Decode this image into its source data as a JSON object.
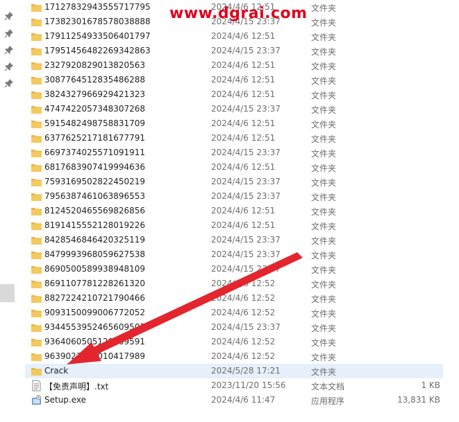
{
  "watermark": "www.dgrai.com",
  "accent_colors": {
    "folder": "#f4c95d",
    "selection": "#e5f0fb",
    "arrow": "#e3262e"
  },
  "nav_pane": {
    "pins": [
      "pin-icon",
      "pin-icon",
      "pin-icon",
      "pin-icon",
      "pin-icon"
    ]
  },
  "files": [
    {
      "name": "17127832943555717795",
      "date": "2024/4/6 12:51",
      "type": "文件夹",
      "size": "",
      "icon": "folder-icon"
    },
    {
      "name": "17382301678578038888",
      "date": "2024/4/15 23:37",
      "type": "文件夹",
      "size": "",
      "icon": "folder-icon"
    },
    {
      "name": "17911254933506401797",
      "date": "2024/4/6 12:51",
      "type": "文件夹",
      "size": "",
      "icon": "folder-icon"
    },
    {
      "name": "17951456482269342863",
      "date": "2024/4/15 23:37",
      "type": "文件夹",
      "size": "",
      "icon": "folder-icon"
    },
    {
      "name": "2327920829013820563",
      "date": "2024/4/6 12:51",
      "type": "文件夹",
      "size": "",
      "icon": "folder-icon"
    },
    {
      "name": "3087764512835486288",
      "date": "2024/4/6 12:51",
      "type": "文件夹",
      "size": "",
      "icon": "folder-icon"
    },
    {
      "name": "3824327966929421323",
      "date": "2024/4/6 12:51",
      "type": "文件夹",
      "size": "",
      "icon": "folder-icon"
    },
    {
      "name": "4747422057348307268",
      "date": "2024/4/15 23:37",
      "type": "文件夹",
      "size": "",
      "icon": "folder-icon"
    },
    {
      "name": "5915482498758831709",
      "date": "2024/4/6 12:51",
      "type": "文件夹",
      "size": "",
      "icon": "folder-icon"
    },
    {
      "name": "6377625217181677791",
      "date": "2024/4/6 12:51",
      "type": "文件夹",
      "size": "",
      "icon": "folder-icon"
    },
    {
      "name": "6697374025571091911",
      "date": "2024/4/15 23:37",
      "type": "文件夹",
      "size": "",
      "icon": "folder-icon"
    },
    {
      "name": "6817683907419994636",
      "date": "2024/4/6 12:51",
      "type": "文件夹",
      "size": "",
      "icon": "folder-icon"
    },
    {
      "name": "7593169502822450219",
      "date": "2024/4/15 23:37",
      "type": "文件夹",
      "size": "",
      "icon": "folder-icon"
    },
    {
      "name": "7956387461063896553",
      "date": "2024/4/15 23:37",
      "type": "文件夹",
      "size": "",
      "icon": "folder-icon"
    },
    {
      "name": "8124520465569826856",
      "date": "2024/4/6 12:51",
      "type": "文件夹",
      "size": "",
      "icon": "folder-icon"
    },
    {
      "name": "8191415552128019226",
      "date": "2024/4/6 12:51",
      "type": "文件夹",
      "size": "",
      "icon": "folder-icon"
    },
    {
      "name": "8428546846420325119",
      "date": "2024/4/15 23:37",
      "type": "文件夹",
      "size": "",
      "icon": "folder-icon"
    },
    {
      "name": "8479993968059627538",
      "date": "2024/4/15 23:37",
      "type": "文件夹",
      "size": "",
      "icon": "folder-icon"
    },
    {
      "name": "8690500589938948109",
      "date": "2024/4/15 23:37",
      "type": "文件夹",
      "size": "",
      "icon": "folder-icon"
    },
    {
      "name": "8691107781228261320",
      "date": "2024/4/6 12:52",
      "type": "文件夹",
      "size": "",
      "icon": "folder-icon"
    },
    {
      "name": "8827224210721790466",
      "date": "2024/4/6 12:52",
      "type": "文件夹",
      "size": "",
      "icon": "folder-icon"
    },
    {
      "name": "9093150099006772052",
      "date": "2024/4/6 12:52",
      "type": "文件夹",
      "size": "",
      "icon": "folder-icon"
    },
    {
      "name": "9344553952465609507",
      "date": "2024/4/15 23:37",
      "type": "文件夹",
      "size": "",
      "icon": "folder-icon"
    },
    {
      "name": "9364060505129609591",
      "date": "2024/4/6 12:52",
      "type": "文件夹",
      "size": "",
      "icon": "folder-icon"
    },
    {
      "name": "9639023817010417989",
      "date": "2024/4/6 12:52",
      "type": "文件夹",
      "size": "",
      "icon": "folder-icon"
    },
    {
      "name": "Crack",
      "date": "2024/5/28 17:21",
      "type": "文件夹",
      "size": "",
      "icon": "folder-icon",
      "selected": true
    },
    {
      "name": "【免责声明】.txt",
      "date": "2023/11/20 15:56",
      "type": "文本文档",
      "size": "1 KB",
      "icon": "text-file-icon"
    },
    {
      "name": "Setup.exe",
      "date": "2024/4/6 11:47",
      "type": "应用程序",
      "size": "13,831 KB",
      "icon": "setup-exe-icon"
    }
  ]
}
